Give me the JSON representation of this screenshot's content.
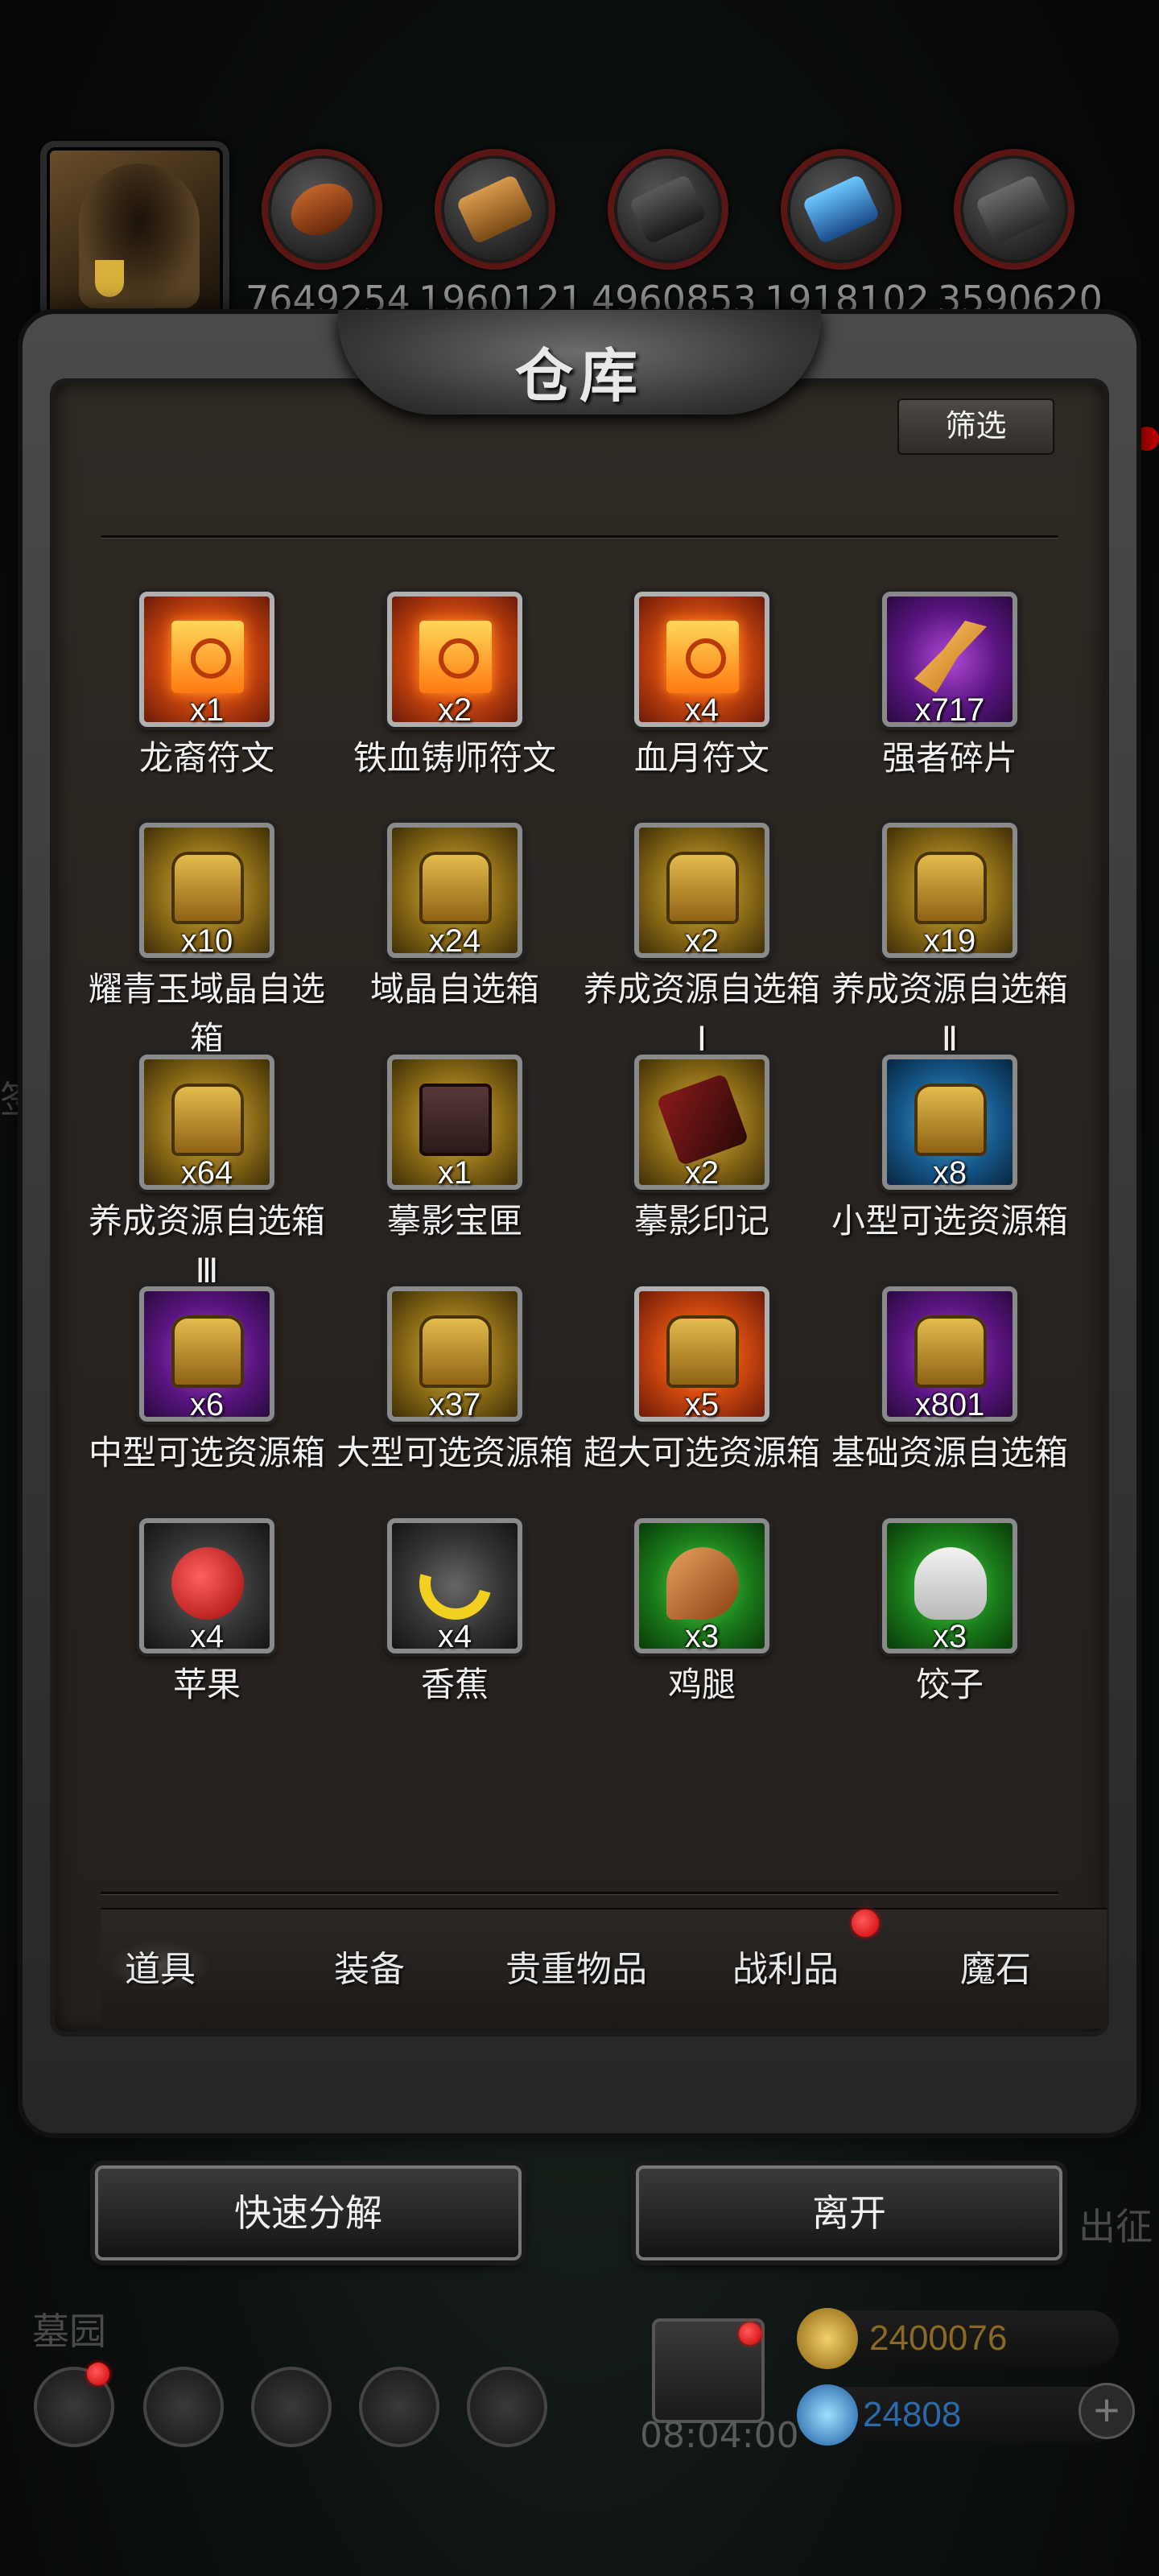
{
  "resources": {
    "values": [
      "7649254",
      "1960121",
      "4960853",
      "1918102",
      "3590620"
    ],
    "icons": [
      "wood-log-icon",
      "plank-icon",
      "stone-icon",
      "crystal-icon",
      "iron-icon"
    ]
  },
  "panel": {
    "title": "仓库",
    "filter_label": "筛选"
  },
  "items": [
    {
      "name": "龙裔符文",
      "qty": "x1",
      "rarity": "orange",
      "icon": "rune-icon"
    },
    {
      "name": "铁血铸师符文",
      "qty": "x2",
      "rarity": "orange",
      "icon": "rune-icon"
    },
    {
      "name": "血月符文",
      "qty": "x4",
      "rarity": "orange",
      "icon": "rune-icon"
    },
    {
      "name": "强者碎片",
      "qty": "x717",
      "rarity": "purple",
      "icon": "shard-icon"
    },
    {
      "name": "耀青玉域晶自选箱",
      "qty": "x10",
      "rarity": "gold",
      "icon": "chest-icon"
    },
    {
      "name": "域晶自选箱",
      "qty": "x24",
      "rarity": "gold",
      "icon": "chest-icon"
    },
    {
      "name": "养成资源自选箱Ⅰ",
      "qty": "x2",
      "rarity": "gold",
      "icon": "chest-icon"
    },
    {
      "name": "养成资源自选箱Ⅱ",
      "qty": "x19",
      "rarity": "gold",
      "icon": "chest-icon"
    },
    {
      "name": "养成资源自选箱Ⅲ",
      "qty": "x64",
      "rarity": "gold",
      "icon": "chest-icon"
    },
    {
      "name": "摹影宝匣",
      "qty": "x1",
      "rarity": "gold",
      "icon": "box-icon"
    },
    {
      "name": "摹影印记",
      "qty": "x2",
      "rarity": "gold",
      "icon": "seal-icon"
    },
    {
      "name": "小型可选资源箱",
      "qty": "x8",
      "rarity": "blue",
      "icon": "chest-icon"
    },
    {
      "name": "中型可选资源箱",
      "qty": "x6",
      "rarity": "purple",
      "icon": "chest-icon"
    },
    {
      "name": "大型可选资源箱",
      "qty": "x37",
      "rarity": "gold",
      "icon": "chest-icon"
    },
    {
      "name": "超大可选资源箱",
      "qty": "x5",
      "rarity": "orange",
      "icon": "chest-icon"
    },
    {
      "name": "基础资源自选箱",
      "qty": "x801",
      "rarity": "purple",
      "icon": "chest-icon"
    },
    {
      "name": "苹果",
      "qty": "x4",
      "rarity": "gray",
      "icon": "apple-icon"
    },
    {
      "name": "香蕉",
      "qty": "x4",
      "rarity": "gray",
      "icon": "banana-icon"
    },
    {
      "name": "鸡腿",
      "qty": "x3",
      "rarity": "green",
      "icon": "drumstick-icon"
    },
    {
      "name": "饺子",
      "qty": "x3",
      "rarity": "green",
      "icon": "dumpling-icon"
    }
  ],
  "tabs": [
    {
      "label": "道具",
      "active": true
    },
    {
      "label": "装备",
      "active": false
    },
    {
      "label": "贵重物品",
      "active": false
    },
    {
      "label": "战利品",
      "active": false,
      "badge": true
    },
    {
      "label": "魔石",
      "active": false
    }
  ],
  "buttons": {
    "decompose": "快速分解",
    "leave": "离开"
  },
  "hud": {
    "area_name": "墓园",
    "side_label_right": "出征",
    "side_label_left": "签到",
    "timer": "08:04:00",
    "gold": "2400076",
    "gems": "24808"
  },
  "colors": {
    "badge_red": "#e00000",
    "gold_text": "#8a6a22",
    "gem_text": "#2a6aa8"
  }
}
